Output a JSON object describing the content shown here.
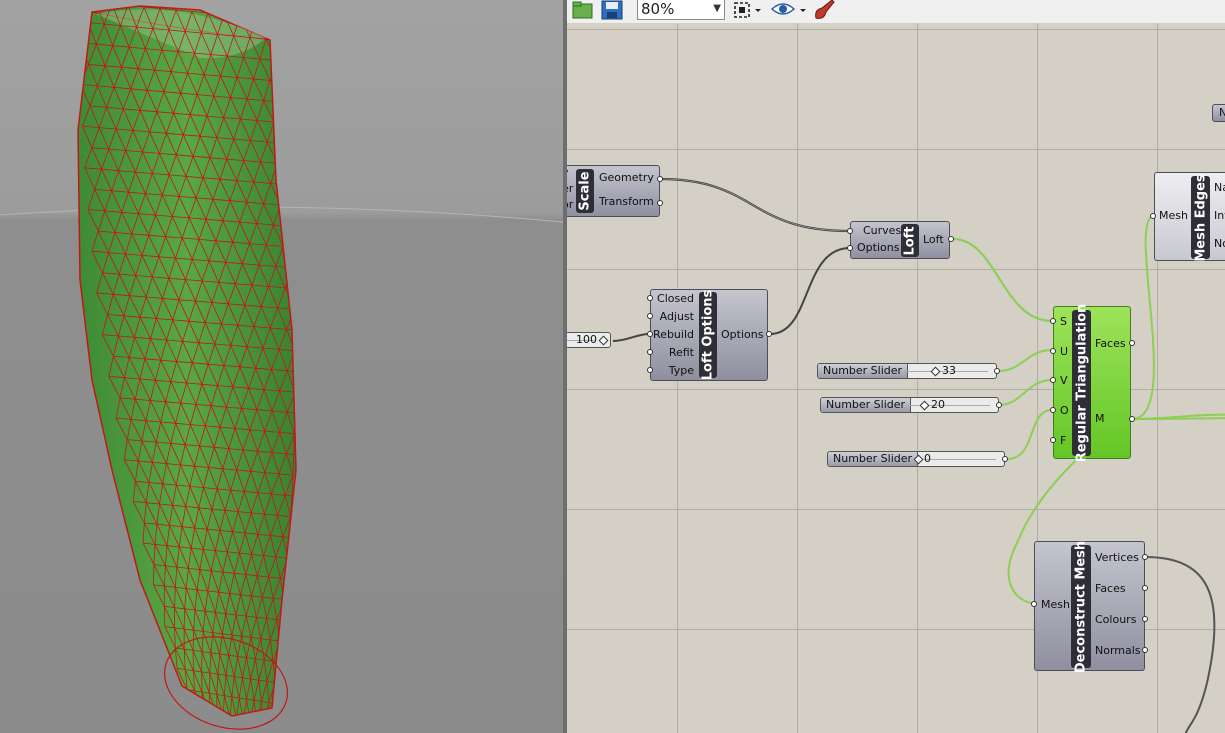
{
  "toolbar": {
    "zoom_value": "80%",
    "icons": [
      "open-file-icon",
      "save-icon",
      "zoom-extents-icon",
      "preview-eye-icon",
      "paint-brush-icon"
    ]
  },
  "canvas": {
    "scale": {
      "title": "Scale",
      "outputs": [
        "Geometry",
        "Transform"
      ],
      "inputs_partial": [
        "y",
        "er",
        "or"
      ]
    },
    "loft": {
      "title": "Loft",
      "inputs": [
        "Curves",
        "Options"
      ],
      "output": "Loft"
    },
    "loft_options": {
      "title": "Loft Options",
      "inputs": [
        "Closed",
        "Adjust",
        "Rebuild",
        "Refit",
        "Type"
      ],
      "output": "Options"
    },
    "rebuild_value": "100",
    "regular_triangulation": {
      "title": "Regular Triangulation",
      "inputs": [
        "S",
        "U",
        "V",
        "O",
        "F"
      ],
      "outputs": [
        "Faces",
        "M"
      ]
    },
    "sliders": [
      {
        "label": "Number Slider",
        "value": "33"
      },
      {
        "label": "Number Slider",
        "value": "20"
      },
      {
        "label": "Number Slider",
        "value": "0"
      }
    ],
    "mesh_edges": {
      "title": "Mesh Edges",
      "input": "Mesh",
      "outputs_partial": [
        "Na",
        "Int",
        "No"
      ]
    },
    "deconstruct_mesh": {
      "title": "Deconstruct Mesh",
      "input": "Mesh",
      "outputs": [
        "Vertices",
        "Faces",
        "Colours",
        "Normals"
      ]
    },
    "top_right_partial": "N"
  },
  "colors": {
    "viewport_bg": "#9a9a9a",
    "mesh_fill": "#4a9a3a",
    "mesh_wire": "#c01818",
    "canvas_bg": "#d4d0c6",
    "selected_component": "#7ed63a",
    "wire": "#555555",
    "wire_selected": "#8ccf55"
  }
}
